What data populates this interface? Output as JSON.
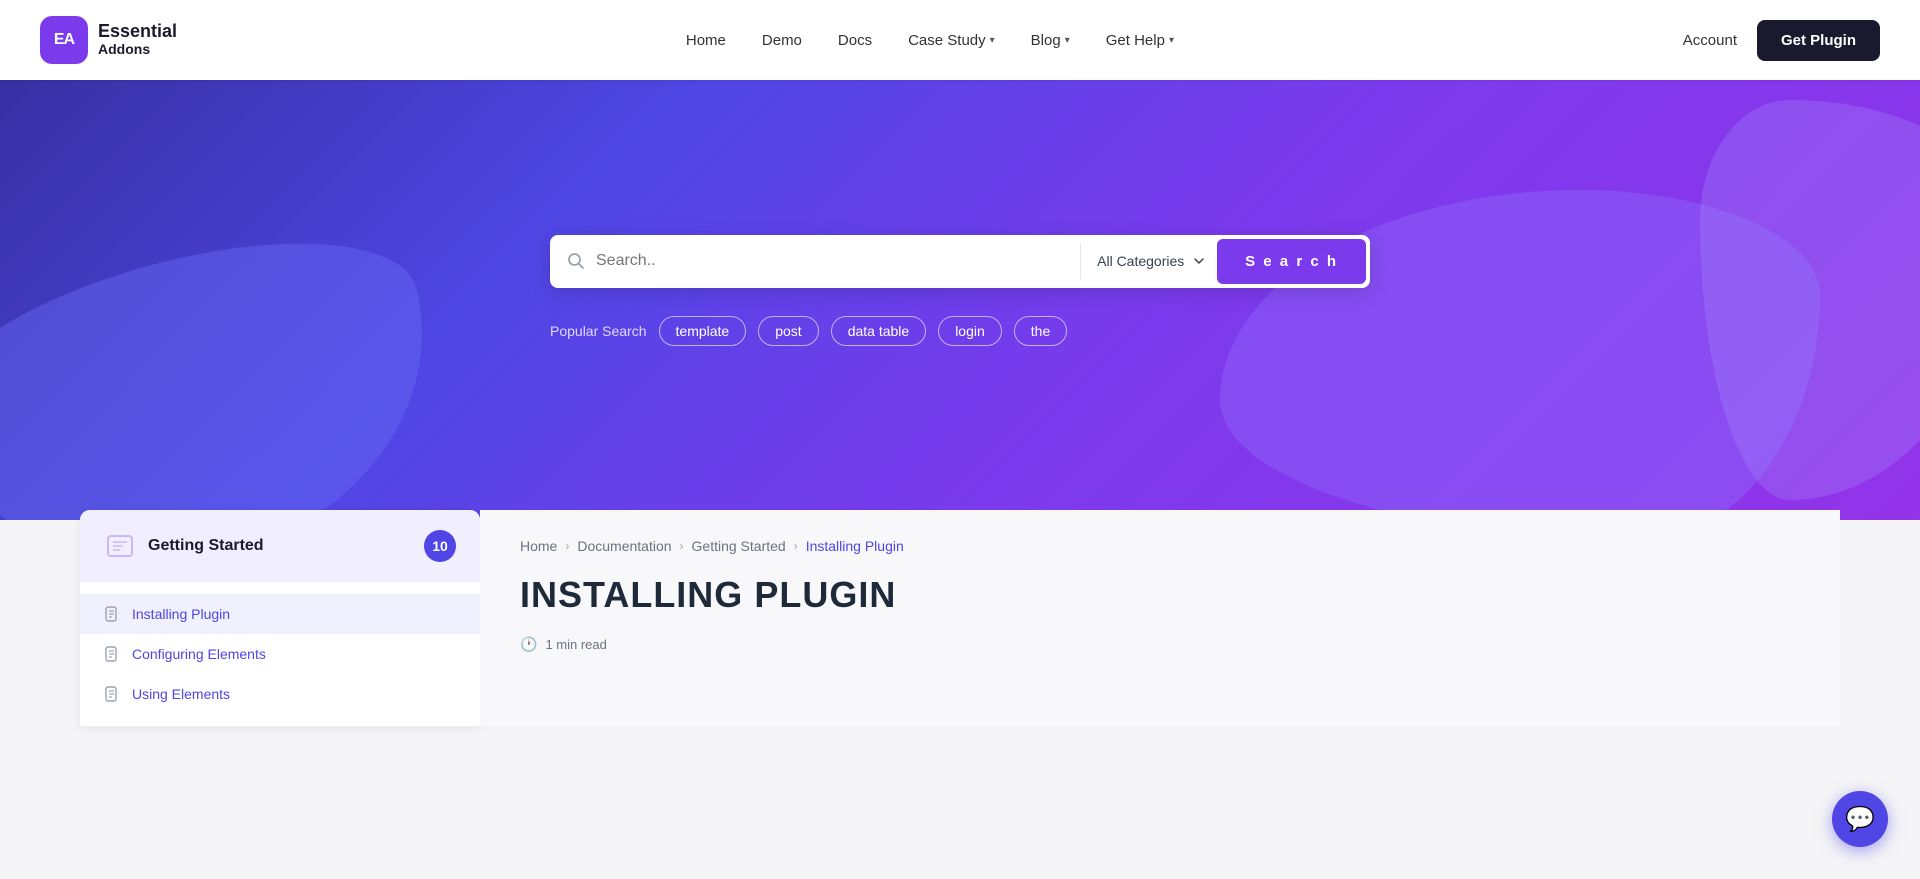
{
  "header": {
    "logo_initials": "EA",
    "brand_line1": "Essential",
    "brand_line2": "Addons",
    "nav_items": [
      {
        "label": "Home",
        "has_dropdown": false
      },
      {
        "label": "Demo",
        "has_dropdown": false
      },
      {
        "label": "Docs",
        "has_dropdown": false
      },
      {
        "label": "Case Study",
        "has_dropdown": true
      },
      {
        "label": "Blog",
        "has_dropdown": true
      },
      {
        "label": "Get Help",
        "has_dropdown": true
      }
    ],
    "account_label": "Account",
    "get_plugin_label": "Get Plugin"
  },
  "hero": {
    "search_placeholder": "Search..",
    "category_default": "All Categories",
    "search_button_label": "S e a r c h",
    "popular_search_label": "Popular Search",
    "popular_tags": [
      "template",
      "post",
      "data table",
      "login",
      "the"
    ]
  },
  "sidebar": {
    "section_title": "Getting Started",
    "badge_count": "10",
    "items": [
      {
        "label": "Installing Plugin",
        "active": true
      },
      {
        "label": "Configuring Elements",
        "active": false
      },
      {
        "label": "Using Elements",
        "active": false
      }
    ]
  },
  "breadcrumb": {
    "items": [
      {
        "label": "Home",
        "active": false
      },
      {
        "label": "Documentation",
        "active": false
      },
      {
        "label": "Getting Started",
        "active": false
      },
      {
        "label": "Installing Plugin",
        "active": true
      }
    ]
  },
  "main": {
    "page_title": "INSTALLING PLUGIN",
    "read_time": "1 min read"
  },
  "chat": {
    "icon": "💬"
  }
}
